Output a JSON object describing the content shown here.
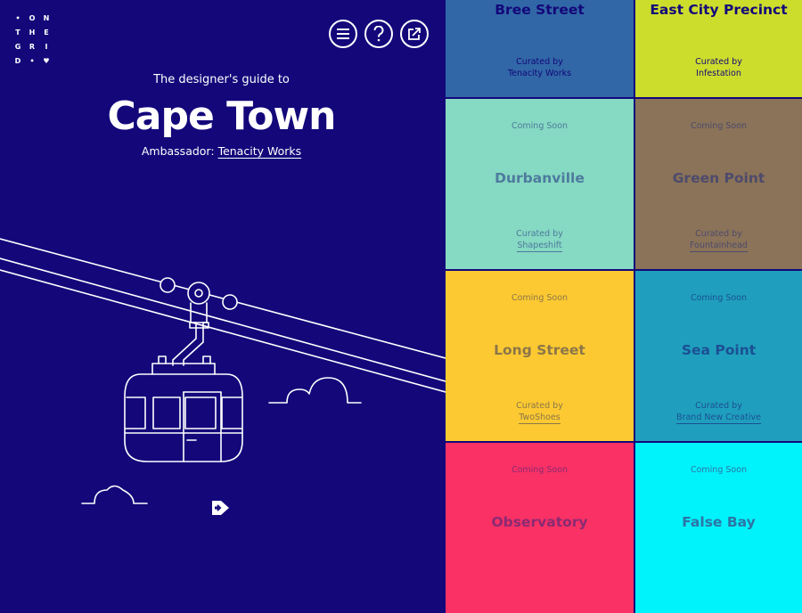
{
  "logo": {
    "letters": [
      "O",
      "N",
      "T",
      "H",
      "E",
      "G",
      "R",
      "I",
      "D"
    ]
  },
  "header": {
    "menu_icon": "menu-icon",
    "help_icon": "question-icon",
    "share_icon": "share-icon"
  },
  "guide": {
    "subtitle": "The designer's guide to",
    "city": "Cape Town",
    "ambassador_prefix": "Ambassador:",
    "ambassador_name": "Tenacity Works"
  },
  "tiles": [
    {
      "name": "Bree Street",
      "coming": "",
      "curated_label": "Curated by",
      "curator": "Tenacity Works",
      "bg": "#3167a6",
      "fg": "#13077a"
    },
    {
      "name": "East City Precinct",
      "coming": "",
      "curated_label": "Curated by",
      "curator": "Infestation",
      "bg": "#cddd2c",
      "fg": "#13077a"
    },
    {
      "name": "Durbanville",
      "coming": "Coming Soon",
      "curated_label": "Curated by",
      "curator": "Shapeshift",
      "bg": "#86d9c2",
      "fg": "#4d7a9e"
    },
    {
      "name": "Green Point",
      "coming": "Coming Soon",
      "curated_label": "Curated by",
      "curator": "Fountainhead",
      "bg": "#8a7358",
      "fg": "#4e4a6c"
    },
    {
      "name": "Long Street",
      "coming": "Coming Soon",
      "curated_label": "Curated by",
      "curator": "TwoShoes",
      "bg": "#fcc932",
      "fg": "#8c7648"
    },
    {
      "name": "Sea Point",
      "coming": "Coming Soon",
      "curated_label": "Curated by",
      "curator": "Brand New Creative",
      "bg": "#1f9fbd",
      "fg": "#1b4f94"
    },
    {
      "name": "Observatory",
      "coming": "Coming Soon",
      "curated_label": "",
      "curator": "",
      "bg": "#fa3165",
      "fg": "#8a2a72"
    },
    {
      "name": "False Bay",
      "coming": "Coming Soon",
      "curated_label": "",
      "curator": "",
      "bg": "#00f2fa",
      "fg": "#2d74a6"
    }
  ],
  "colors": {
    "background": "#13077a",
    "line": "#ffffff"
  }
}
